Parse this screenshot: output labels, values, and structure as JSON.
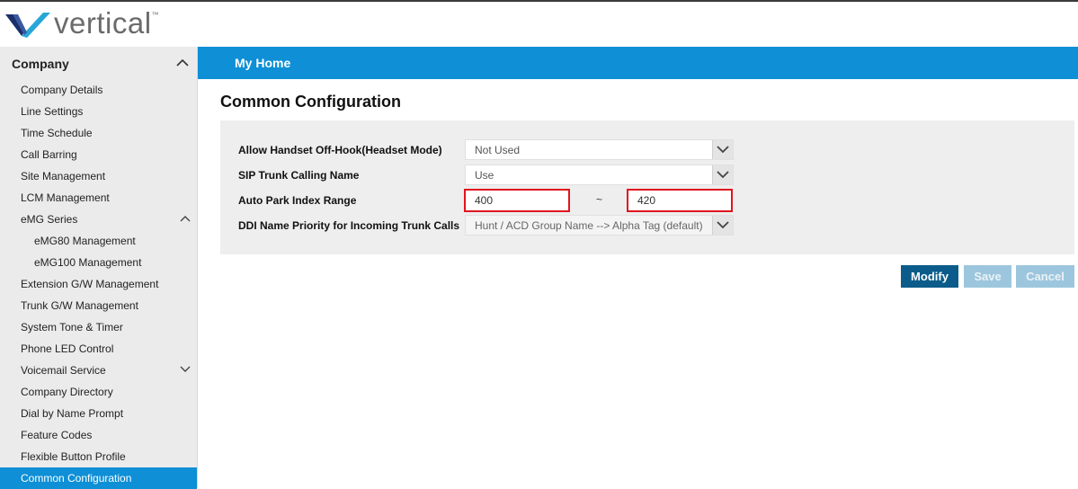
{
  "header": {
    "logo_text": "vertical",
    "logo_tm": "™"
  },
  "sidebar": {
    "section_title": "Company",
    "items": [
      {
        "label": "Company Details"
      },
      {
        "label": "Line Settings"
      },
      {
        "label": "Time Schedule"
      },
      {
        "label": "Call Barring"
      },
      {
        "label": "Site Management"
      },
      {
        "label": "LCM Management"
      },
      {
        "label": "eMG Series",
        "expandable": "expanded"
      },
      {
        "label": "eMG80 Management",
        "sub": true
      },
      {
        "label": "eMG100 Management",
        "sub": true
      },
      {
        "label": "Extension G/W Management"
      },
      {
        "label": "Trunk G/W Management"
      },
      {
        "label": "System Tone & Timer"
      },
      {
        "label": "Phone LED Control"
      },
      {
        "label": "Voicemail Service",
        "expandable": "collapsed"
      },
      {
        "label": "Company Directory"
      },
      {
        "label": "Dial by Name Prompt"
      },
      {
        "label": "Feature Codes"
      },
      {
        "label": "Flexible Button Profile"
      },
      {
        "label": "Common Configuration",
        "active": true
      }
    ]
  },
  "topbar": {
    "label": "My Home"
  },
  "main": {
    "title": "Common Configuration",
    "rows": [
      {
        "label": "Allow Handset Off-Hook(Headset Mode)",
        "value": "Not Used"
      },
      {
        "label": "SIP Trunk Calling Name",
        "value": "Use"
      },
      {
        "label": "Auto Park Index Range",
        "from": "400",
        "separator": "~",
        "to": "420"
      },
      {
        "label": "DDI Name Priority for Incoming Trunk Calls",
        "value": "Hunt / ACD Group Name --> Alpha Tag (default)"
      }
    ]
  },
  "actions": {
    "modify": "Modify",
    "save": "Save",
    "cancel": "Cancel"
  },
  "colors": {
    "accent": "#0e8fd6",
    "primary_button": "#0b5c8a",
    "disabled_button": "#9cc6dd",
    "highlight_border": "#e0141e"
  }
}
